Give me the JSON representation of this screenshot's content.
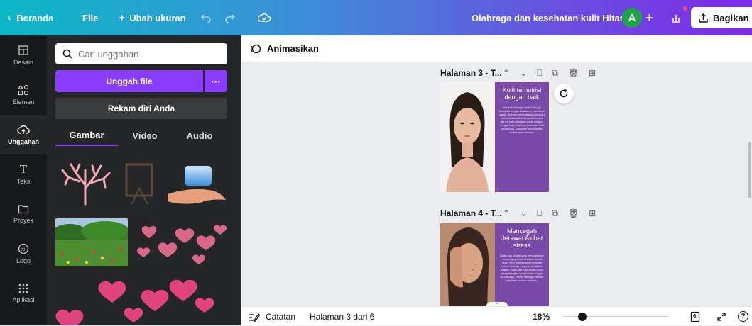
{
  "topbar": {
    "home_label": "Beranda",
    "file_label": "File",
    "resize_label": "Ubah ukuran",
    "doc_title": "Olahraga dan kesehatan kulit Hitami",
    "avatar_letter": "A",
    "share_label": "Bagikan"
  },
  "rail": {
    "items": [
      {
        "label": "Desain",
        "icon": "layout-icon"
      },
      {
        "label": "Elemen",
        "icon": "shapes-icon"
      },
      {
        "label": "Unggahan",
        "icon": "cloud-upload-icon"
      },
      {
        "label": "Teks",
        "icon": "text-icon"
      },
      {
        "label": "Proyek",
        "icon": "folder-icon"
      },
      {
        "label": "Logo",
        "icon": "logo-icon"
      },
      {
        "label": "Aplikasi",
        "icon": "apps-grid-icon"
      }
    ]
  },
  "panel": {
    "search_placeholder": "Cari unggahan",
    "upload_label": "Unggah file",
    "more_label": "···",
    "record_label": "Rekam diri Anda",
    "tabs": [
      "Gambar",
      "Video",
      "Audio"
    ]
  },
  "subbar": {
    "animate_label": "Animasikan"
  },
  "pages": [
    {
      "header": "Halaman 3 - T...",
      "title": "Kulit ternutrisi dengan baik",
      "body": "Manfaat olahraga untuk kulit juga berkaitan dengan kelancaran peredaran darah. Olahraga meningkatkan sirkulasi darah dalam tubuh. Ini berarti bahwa sel-sel kulit mendapat suplai oksigen dengan baik. Hasilnya, kesehatan kulit pun terjaga. Kulit tetap ternutrisi dan terlihat cerah merona."
    },
    {
      "header": "Halaman 4 - T...",
      "title": "Mencegah Jerawat Akibat stress",
      "body": "Salah satu kondisi yang menyebabkan munculnya jerawat di wajah adalah stres. Stres menyebabkan produksi sebum berlebih, yang menyebabkan jerawat. Salah satu cara mudah untuk menghilangkan stres adalah dengan berolahraga, karena olahraga memicu pelepasan hormon endorfin..."
    }
  ],
  "bottombar": {
    "notes_label": "Catatan",
    "page_indicator": "Halaman 3 dari 6",
    "zoom": "18%",
    "zoom_level": 0.18,
    "page_count_badge": "6",
    "help_label": "?"
  },
  "colors": {
    "accent": "#8b3dff",
    "panel_bg": "#252627",
    "rail_bg": "#18191b",
    "design_purple": "#7b4aa8",
    "avatar_green": "#1ea34a"
  }
}
